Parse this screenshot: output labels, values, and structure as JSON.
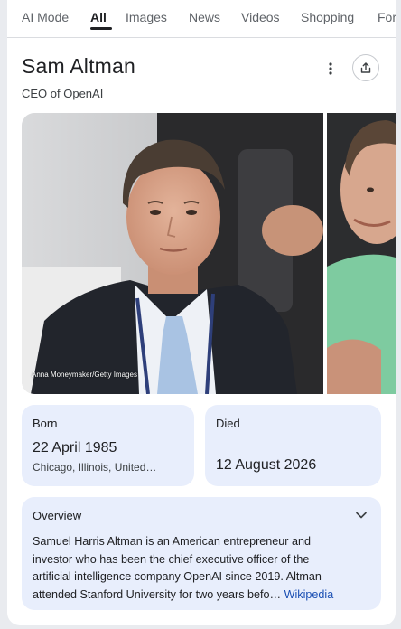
{
  "tabs": [
    {
      "label": "AI Mode"
    },
    {
      "label": "All"
    },
    {
      "label": "Images"
    },
    {
      "label": "News"
    },
    {
      "label": "Videos"
    },
    {
      "label": "Shopping"
    },
    {
      "label": "For"
    }
  ],
  "active_tab": "All",
  "header": {
    "title": "Sam Altman",
    "subtitle": "CEO of OpenAI"
  },
  "images": {
    "main_credit": "Anna Moneymaker/Getty Images"
  },
  "facts": {
    "born": {
      "label": "Born",
      "value": "22 April 1985",
      "sub": "Chicago, Illinois, United…"
    },
    "died": {
      "label": "Died",
      "value": "12 August 2026"
    }
  },
  "overview": {
    "title": "Overview",
    "line1": "Samuel Harris Altman is an American entrepreneur and",
    "line2": "investor who has been the chief executive officer of the",
    "line3": "artificial intelligence company OpenAI since 2019. Altman",
    "line4": "attended Stanford University for two years befo",
    "ellipsis": "…",
    "link": "Wikipedia"
  },
  "colors": {
    "card_bg": "#e8eefc",
    "link": "#1a4fb3",
    "text": "#202124"
  },
  "icons": [
    "more-vert-icon",
    "share-icon",
    "chevron-down-icon"
  ]
}
